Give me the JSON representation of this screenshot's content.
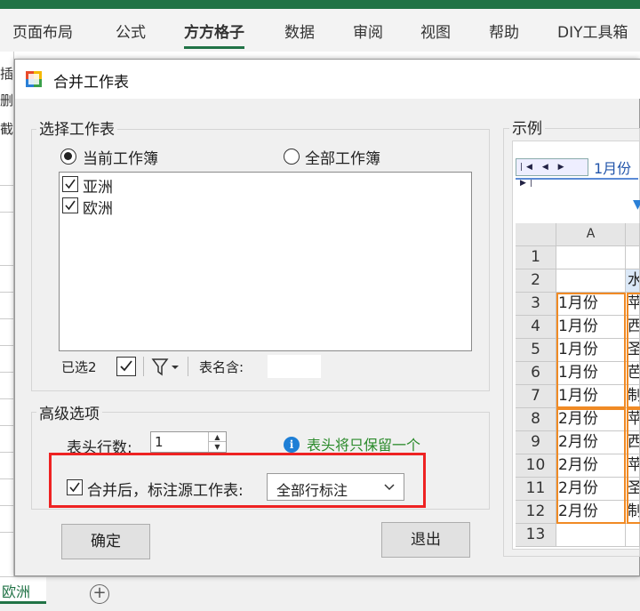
{
  "ribbon": {
    "tabs": [
      "页面布局",
      "公式",
      "方方格子",
      "数据",
      "审阅",
      "视图",
      "帮助",
      "DIY工具箱"
    ],
    "active_tab": "方方格子",
    "accent_color": "#217346"
  },
  "left_strip": {
    "glyphs": [
      "插",
      "删",
      "截"
    ]
  },
  "sheet_tabs": {
    "current": "欧洲",
    "add_icon": "+"
  },
  "dialog": {
    "title": "合并工作表",
    "select_group": {
      "label": "选择工作表",
      "radio_current": "当前工作簿",
      "radio_all": "全部工作簿",
      "selected_radio": "当前工作簿",
      "sheets": [
        "亚洲",
        "欧洲"
      ],
      "selected_count_label": "已选2",
      "name_contains_label": "表名含:"
    },
    "advanced_group": {
      "label": "高级选项",
      "header_rows_label": "表头行数:",
      "header_rows_value": "1",
      "info_text": "表头将只保留一个",
      "mark_source_label": "合并后，标注源工作表:",
      "mark_source_option": "全部行标注"
    },
    "ok_label": "确定",
    "exit_label": "退出",
    "example": {
      "label": "示例",
      "sheet_name": "1月份",
      "col_header": "A",
      "row_numbers": [
        "1",
        "2",
        "3",
        "4",
        "5",
        "6",
        "7",
        "8",
        "9",
        "10",
        "11",
        "12",
        "13"
      ],
      "col_a": [
        "",
        "",
        "1月份",
        "1月份",
        "1月份",
        "1月份",
        "1月份",
        "2月份",
        "2月份",
        "2月份",
        "2月份",
        "2月份",
        ""
      ],
      "col_b": [
        "",
        "水",
        "苹",
        "西",
        "圣",
        "芭",
        "制",
        "苹",
        "西",
        "苹",
        "圣",
        "制",
        ""
      ]
    }
  }
}
